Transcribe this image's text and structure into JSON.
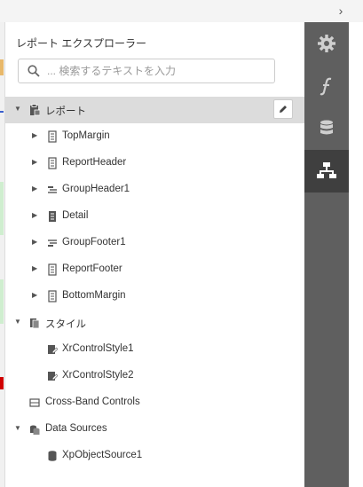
{
  "panel": {
    "title": "レポート エクスプローラー",
    "search_placeholder": "... 検索するテキストを入力"
  },
  "tree": {
    "root": "レポート",
    "bands": [
      "TopMargin",
      "ReportHeader",
      "GroupHeader1",
      "Detail",
      "GroupFooter1",
      "ReportFooter",
      "BottomMargin"
    ],
    "styles_label": "スタイル",
    "styles": [
      "XrControlStyle1",
      "XrControlStyle2"
    ],
    "cross_band": "Cross-Band Controls",
    "data_sources_label": "Data Sources",
    "data_sources": [
      "XpObjectSource1"
    ]
  },
  "sidebar": {
    "tabs": [
      {
        "icon": "gear-icon",
        "active": false
      },
      {
        "icon": "function-icon",
        "active": false
      },
      {
        "icon": "database-icon",
        "active": false
      },
      {
        "icon": "hierarchy-icon",
        "active": true
      }
    ]
  },
  "colors": {
    "sidebar_bg": "#5f5f5f",
    "sidebar_active": "#3f3f3f",
    "selected_row": "#dcdcdc"
  }
}
